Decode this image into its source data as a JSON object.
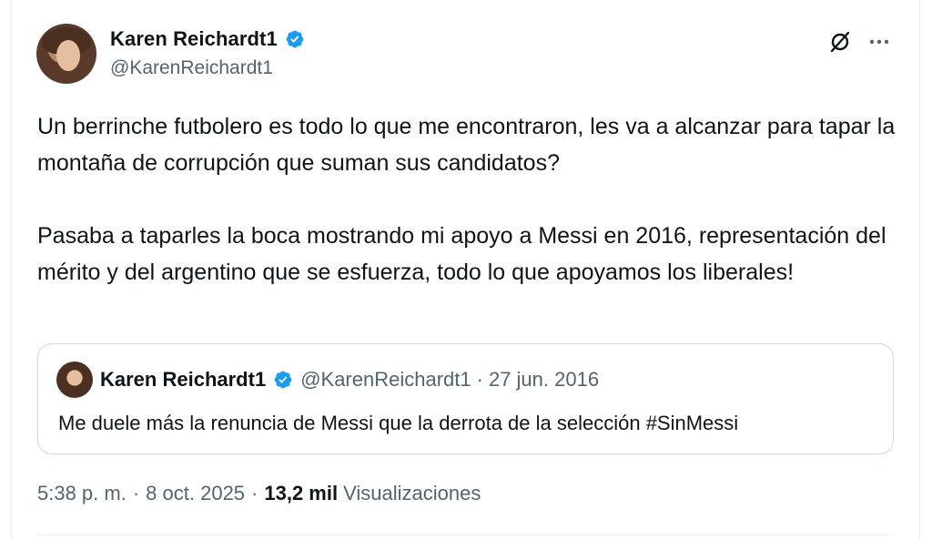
{
  "author": {
    "name": "Karen Reichardt1",
    "handle": "@KarenReichardt1",
    "verified": true
  },
  "tweet": {
    "paragraph1": "Un berrinche futbolero es todo lo que me encontraron,  les va a alcanzar para tapar la montaña de corrupción que suman sus candidatos?",
    "paragraph2": "Pasaba a taparles la boca mostrando mi apoyo a Messi en 2016, representación del mérito y del argentino que se esfuerza, todo lo que apoyamos los liberales!"
  },
  "quote": {
    "name": "Karen Reichardt1",
    "handle": "@KarenReichardt1",
    "separator": "·",
    "date": "27 jun. 2016",
    "text": "Me duele más la renuncia de Messi que la derrota de la selección #SinMessi"
  },
  "meta": {
    "time": "5:38 p. m.",
    "separator": "·",
    "date": "8 oct. 2025",
    "separator2": "·",
    "views_count": "13,2 mil",
    "views_label": "Visualizaciones"
  },
  "icons": {
    "grok": "grok-icon",
    "more": "more-icon",
    "verified": "verified-badge-icon"
  },
  "colors": {
    "verified_blue": "#1d9bf0",
    "secondary_text": "#536471",
    "border": "#cfd9de"
  }
}
